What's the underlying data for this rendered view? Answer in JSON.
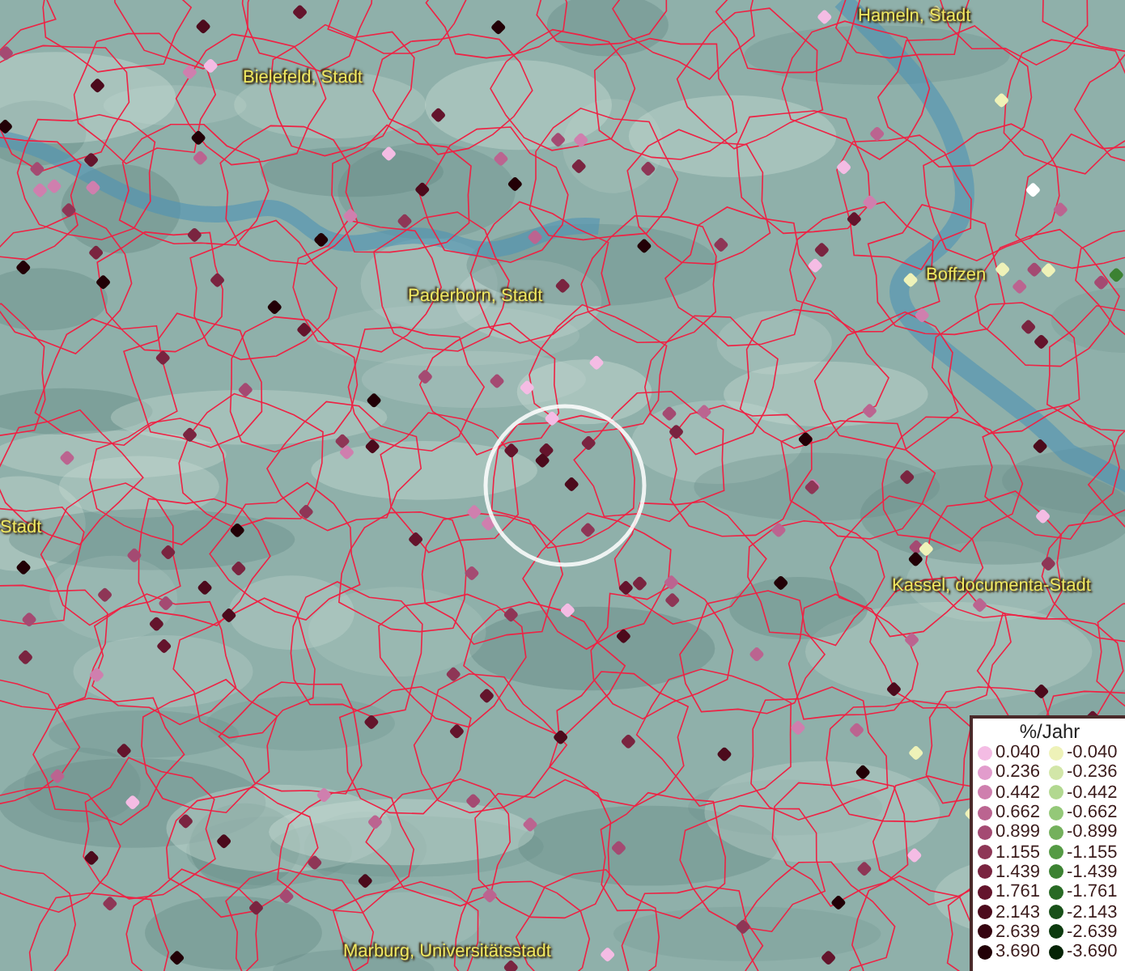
{
  "map_labels": [
    {
      "text": "Hameln, Stadt"
    },
    {
      "text": "Bielefeld, Stadt"
    },
    {
      "text": "Paderborn, Stadt"
    },
    {
      "text": "Boffzen"
    },
    {
      "text": "Stadt"
    },
    {
      "text": "Kassel, documenta-Stadt"
    },
    {
      "text": "Marburg, Universitätsstadt"
    }
  ],
  "legend": {
    "title": "%/Jahr",
    "rows": [
      {
        "positive": {
          "value": "0.040",
          "color": "#f4bce4"
        },
        "negative": {
          "value": "-0.040",
          "color": "#eef2b8"
        }
      },
      {
        "positive": {
          "value": "0.236",
          "color": "#e29ccc"
        },
        "negative": {
          "value": "-0.236",
          "color": "#d2e6a8"
        }
      },
      {
        "positive": {
          "value": "0.442",
          "color": "#cf7fae"
        },
        "negative": {
          "value": "-0.442",
          "color": "#b2d890"
        }
      },
      {
        "positive": {
          "value": "0.662",
          "color": "#bb6490"
        },
        "negative": {
          "value": "-0.662",
          "color": "#94c878"
        }
      },
      {
        "positive": {
          "value": "0.899",
          "color": "#a44a72"
        },
        "negative": {
          "value": "-0.899",
          "color": "#74b05c"
        }
      },
      {
        "positive": {
          "value": "1.155",
          "color": "#8e3656"
        },
        "negative": {
          "value": "-1.155",
          "color": "#559a44"
        }
      },
      {
        "positive": {
          "value": "1.439",
          "color": "#7a2440"
        },
        "negative": {
          "value": "-1.439",
          "color": "#3c8232"
        }
      },
      {
        "positive": {
          "value": "1.761",
          "color": "#64142c"
        },
        "negative": {
          "value": "-1.761",
          "color": "#286a24"
        }
      },
      {
        "positive": {
          "value": "2.143",
          "color": "#4c0a1c"
        },
        "negative": {
          "value": "-2.143",
          "color": "#185018"
        }
      },
      {
        "positive": {
          "value": "2.639",
          "color": "#360410"
        },
        "negative": {
          "value": "-2.639",
          "color": "#0c3a0e"
        }
      },
      {
        "positive": {
          "value": "3.690",
          "color": "#220006"
        },
        "negative": {
          "value": "-3.690",
          "color": "#062406"
        }
      }
    ]
  }
}
